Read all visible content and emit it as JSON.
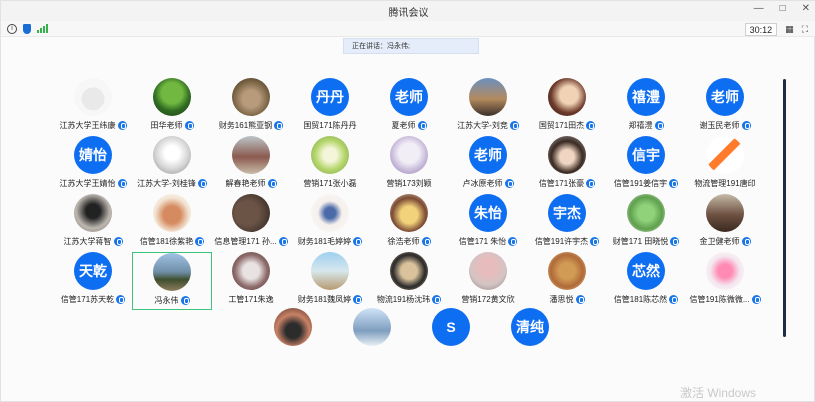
{
  "window": {
    "title": "腾讯会议"
  },
  "toolbar": {
    "timer": "30:12"
  },
  "speaking": {
    "label": "正在讲话：冯永伟;"
  },
  "participants": [
    {
      "name": "江苏大学王纬康",
      "mic": true,
      "text": ""
    },
    {
      "name": "田华老师",
      "mic": true,
      "text": ""
    },
    {
      "name": "财务161熊亚钢",
      "mic": true,
      "text": ""
    },
    {
      "name": "国贸171陈丹丹",
      "mic": false,
      "text": "丹丹"
    },
    {
      "name": "夏老师",
      "mic": true,
      "text": "老师"
    },
    {
      "name": "江苏大学-刘竞",
      "mic": true,
      "text": ""
    },
    {
      "name": "国贸171田杰",
      "mic": true,
      "text": ""
    },
    {
      "name": "郑禧澧",
      "mic": true,
      "text": "禧澧"
    },
    {
      "name": "谢玉民老师",
      "mic": true,
      "text": "老师"
    },
    {
      "name": "江苏大学王婧怡",
      "mic": true,
      "text": "婧怡"
    },
    {
      "name": "江苏大学-刘桂锋",
      "mic": true,
      "text": ""
    },
    {
      "name": "解春艳老师",
      "mic": true,
      "text": ""
    },
    {
      "name": "营销171张小磊",
      "mic": false,
      "text": ""
    },
    {
      "name": "营销173刘颖",
      "mic": false,
      "text": ""
    },
    {
      "name": "卢冰原老师",
      "mic": true,
      "text": "老师"
    },
    {
      "name": "信管171张豪",
      "mic": true,
      "text": ""
    },
    {
      "name": "信管191姜信宇",
      "mic": true,
      "text": "信宇"
    },
    {
      "name": "物流管理191唐印",
      "mic": false,
      "text": ""
    },
    {
      "name": "江苏大学蒋智",
      "mic": true,
      "text": ""
    },
    {
      "name": "信管181徐紫艳",
      "mic": true,
      "text": ""
    },
    {
      "name": "信息管理171 孙...",
      "mic": true,
      "text": ""
    },
    {
      "name": "财务181毛婷婷",
      "mic": true,
      "text": ""
    },
    {
      "name": "徐浩老师",
      "mic": true,
      "text": ""
    },
    {
      "name": "信管171 朱怡",
      "mic": true,
      "text": "朱怡"
    },
    {
      "name": "信管191许宇杰",
      "mic": true,
      "text": "宇杰"
    },
    {
      "name": "财管171 田晓悦",
      "mic": true,
      "text": ""
    },
    {
      "name": "金卫健老师",
      "mic": true,
      "text": ""
    },
    {
      "name": "信管171苏天乾",
      "mic": true,
      "text": "天乾"
    },
    {
      "name": "冯永伟",
      "mic": true,
      "text": "",
      "selected": true
    },
    {
      "name": "工管171朱逸",
      "mic": false,
      "text": ""
    },
    {
      "name": "财务181魏凤婷",
      "mic": true,
      "text": ""
    },
    {
      "name": "物流191杨沈玮",
      "mic": true,
      "text": ""
    },
    {
      "name": "营销172黄文欣",
      "mic": false,
      "text": ""
    },
    {
      "name": "潘思悦",
      "mic": true,
      "text": ""
    },
    {
      "name": "信管181陈芯然",
      "mic": true,
      "text": "芯然"
    },
    {
      "name": "信管191陈微微...",
      "mic": true,
      "text": ""
    },
    {
      "name": "",
      "mic": false,
      "text": ""
    },
    {
      "name": "",
      "mic": false,
      "text": ""
    },
    {
      "name": "",
      "mic": false,
      "text": "S"
    },
    {
      "name": "",
      "mic": false,
      "text": "清纯"
    }
  ],
  "watermark": "激活 Windows"
}
